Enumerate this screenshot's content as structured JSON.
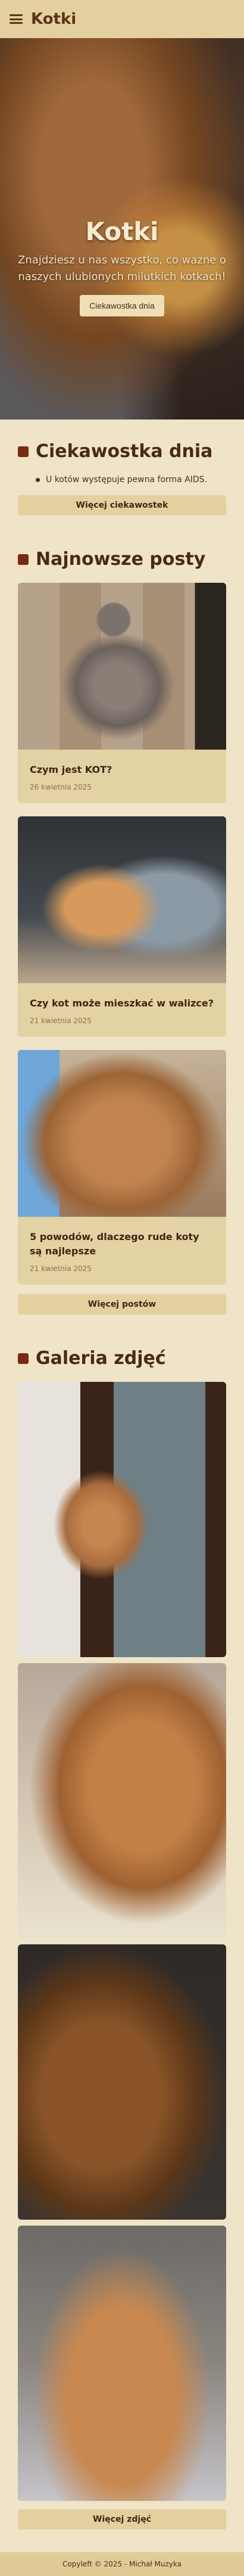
{
  "header": {
    "title": "Kotki",
    "menu_icon": "hamburger-icon"
  },
  "hero": {
    "title": "Kotki",
    "subtitle": "Znajdziesz u nas wszystko, co ważne o naszych ulubionych milutkich kotkach!",
    "button_label": "Ciekawostka dnia"
  },
  "fact_section": {
    "title": "Ciekawostka dnia",
    "fact": "U kotów występuje pewna forma AIDS.",
    "more_label": "Więcej ciekawostek"
  },
  "posts_section": {
    "title": "Najnowsze posty",
    "posts": [
      {
        "title": "Czym jest KOT?",
        "date": "26 kwietnia 2025"
      },
      {
        "title": "Czy kot może mieszkać w walizce?",
        "date": "21 kwietnia 2025"
      },
      {
        "title": "5 powodów, dlaczego rude koty są najlepsze",
        "date": "21 kwietnia 2025"
      }
    ],
    "more_label": "Więcej postów"
  },
  "gallery_section": {
    "title": "Galeria zdjęć",
    "more_label": "Więcej zdjęć"
  },
  "footer": {
    "text": "Copyleft © 2025 - Michał Muzyka"
  },
  "colors": {
    "background": "#efe3c8",
    "header": "#e3cf9f",
    "accent": "#7a2a12",
    "card": "#e3d2a4"
  }
}
